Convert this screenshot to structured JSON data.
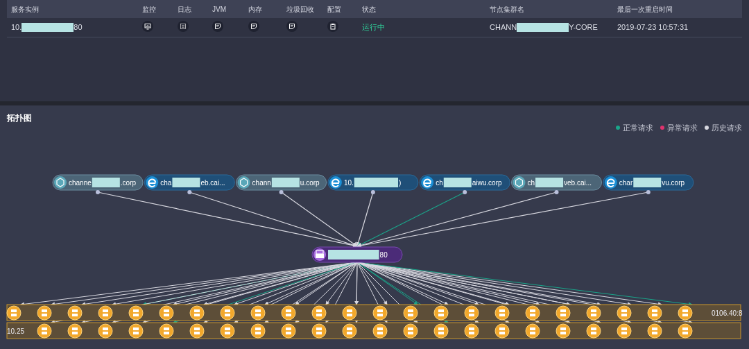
{
  "instances_table": {
    "columns": [
      "服务实例",
      "监控",
      "日志",
      "JVM",
      "内存",
      "垃圾回收",
      "配置",
      "状态",
      "节点集群名",
      "最后一次重启时间"
    ],
    "rows": [
      {
        "instance": {
          "prefix": "10.",
          "suffix": "80"
        },
        "actions": [
          {
            "kind": "monitor"
          },
          {
            "kind": "log"
          },
          {
            "kind": "note"
          },
          {
            "kind": "note"
          },
          {
            "kind": "note"
          },
          {
            "kind": "clipboard"
          }
        ],
        "status": {
          "text": "运行中",
          "kind": "running"
        },
        "cluster": {
          "prefix": "CHANN",
          "suffix": "Y-CORE"
        },
        "restart_time": "2019-07-23 10:57:31"
      }
    ]
  },
  "topology": {
    "title": "拓扑图",
    "legend": [
      {
        "label": "正常请求",
        "color": "#1aa58a"
      },
      {
        "label": "异常请求",
        "color": "#e0336e"
      },
      {
        "label": "历史请求",
        "color": "#d8d8e0"
      }
    ],
    "sources": [
      {
        "kind": "cube",
        "prefix": "channe",
        "suffix": ".corp",
        "normal_request": false
      },
      {
        "kind": "browser",
        "prefix": "cha",
        "suffix": "eb.cai...",
        "normal_request": false
      },
      {
        "kind": "cube",
        "prefix": "chann",
        "suffix": "u.corp",
        "normal_request": false
      },
      {
        "kind": "browser",
        "prefix": "10.",
        "suffix": ")",
        "normal_request": false
      },
      {
        "kind": "browser",
        "prefix": "ch",
        "suffix": "aiwu.corp",
        "normal_request": true
      },
      {
        "kind": "cube",
        "prefix": "ch",
        "suffix": "veb.cai...",
        "normal_request": false
      },
      {
        "kind": "browser",
        "prefix": "char",
        "suffix": "vu.corp",
        "normal_request": false
      }
    ],
    "center": {
      "kind": "database",
      "suffix": "80"
    },
    "server_rows": [
      {
        "trailing_label": "0106.40:8"
      },
      {
        "leading_label": "10.25"
      }
    ]
  }
}
